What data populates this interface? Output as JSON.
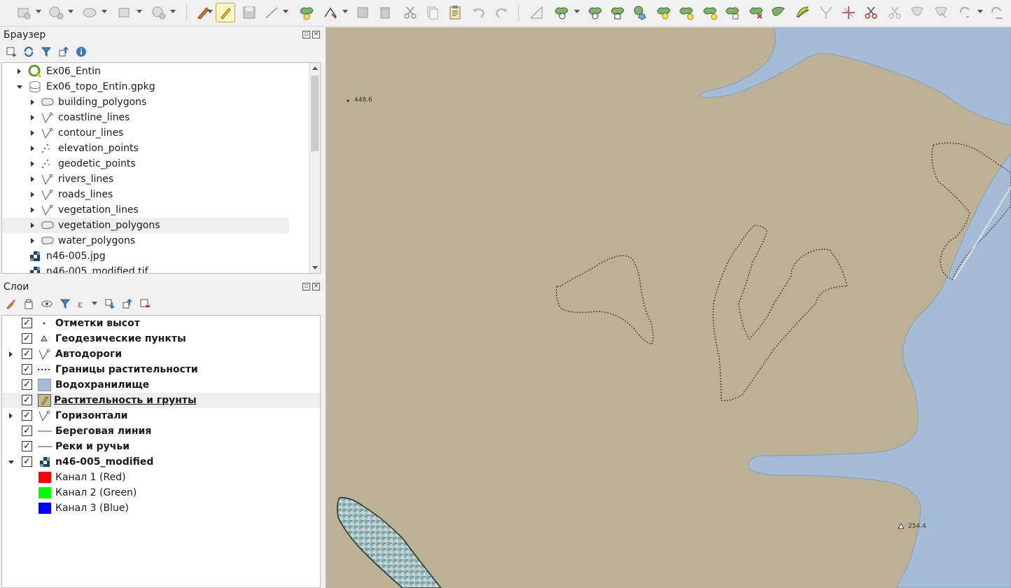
{
  "browser_panel": {
    "title": "Браузер",
    "items": [
      {
        "label": "Ex06_Entin",
        "icon": "qgis-project-icon"
      },
      {
        "label": "Ex06_topo_Entin.gpkg",
        "icon": "geopackage-icon"
      },
      {
        "label": "building_polygons",
        "icon": "polygon-layer-icon"
      },
      {
        "label": "coastline_lines",
        "icon": "line-layer-icon"
      },
      {
        "label": "contour_lines",
        "icon": "line-layer-icon"
      },
      {
        "label": "elevation_points",
        "icon": "point-layer-icon"
      },
      {
        "label": "geodetic_points",
        "icon": "point-layer-icon"
      },
      {
        "label": "rivers_lines",
        "icon": "line-layer-icon"
      },
      {
        "label": "roads_lines",
        "icon": "line-layer-icon"
      },
      {
        "label": "vegetation_lines",
        "icon": "line-layer-icon"
      },
      {
        "label": "vegetation_polygons",
        "icon": "polygon-layer-icon"
      },
      {
        "label": "water_polygons",
        "icon": "polygon-layer-icon"
      },
      {
        "label": "n46-005.jpg",
        "icon": "raster-icon"
      },
      {
        "label": "n46-005_modified.tif",
        "icon": "raster-icon"
      }
    ]
  },
  "layers_panel": {
    "title": "Слои",
    "layers": [
      {
        "label": "Отметки высот",
        "checked": true
      },
      {
        "label": "Геодезические пункты",
        "checked": true
      },
      {
        "label": "Автодороги",
        "checked": true
      },
      {
        "label": "Границы растительности",
        "checked": true
      },
      {
        "label": "Водохранилище",
        "checked": true
      },
      {
        "label": "Растительность и грунты",
        "checked": true
      },
      {
        "label": "Горизонтали",
        "checked": true
      },
      {
        "label": "Береговая линия",
        "checked": true
      },
      {
        "label": "Реки и ручьи",
        "checked": true
      },
      {
        "label": "n46-005_modified",
        "checked": true
      }
    ],
    "bands": [
      {
        "label": "Канал 1 (Red)",
        "color": "#ff0000"
      },
      {
        "label": "Канал 2 (Green)",
        "color": "#00ff00"
      },
      {
        "label": "Канал 3 (Blue)",
        "color": "#0000ff"
      }
    ]
  },
  "map": {
    "labels": {
      "elevation_1": "448.6",
      "elevation_2": "254.4"
    },
    "colors": {
      "land": "#bdb195",
      "water": "#a5bcd6",
      "water_edge": "#7f9ec0"
    }
  }
}
